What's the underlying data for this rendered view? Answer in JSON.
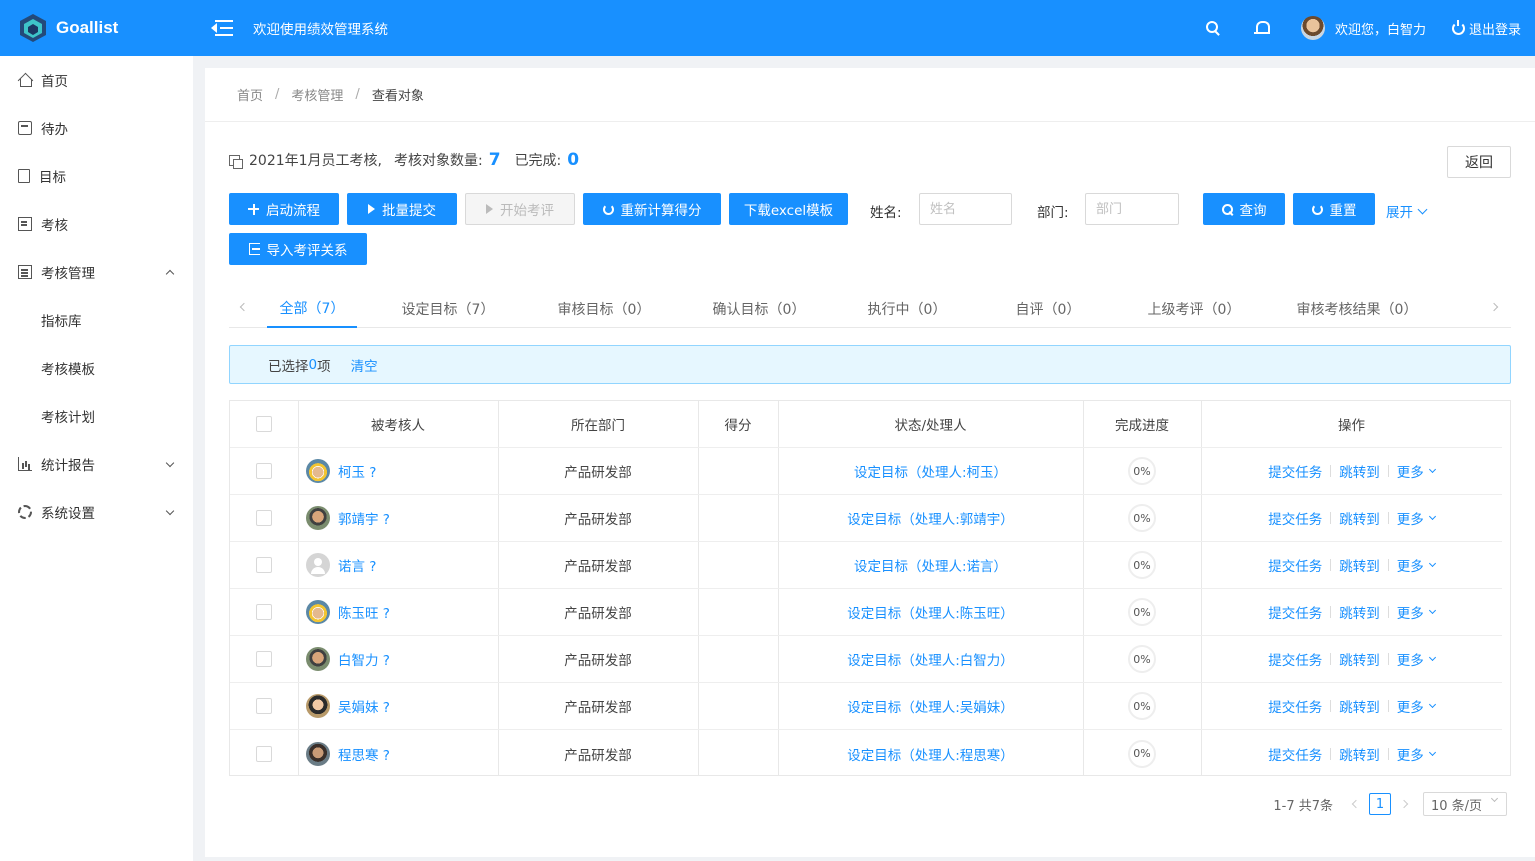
{
  "app": {
    "name": "Goallist",
    "welcome": "欢迎使用绩效管理系统"
  },
  "header": {
    "greeting": "欢迎您，白智力",
    "logout": "退出登录"
  },
  "sidebar": {
    "items": [
      {
        "label": "首页",
        "icon": "home-icon"
      },
      {
        "label": "待办",
        "icon": "calendar-icon"
      },
      {
        "label": "目标",
        "icon": "document-icon"
      },
      {
        "label": "考核",
        "icon": "checklist-icon"
      },
      {
        "label": "考核管理",
        "icon": "list-icon",
        "expanded": true
      },
      {
        "label": "指标库"
      },
      {
        "label": "考核模板"
      },
      {
        "label": "考核计划"
      },
      {
        "label": "统计报告",
        "icon": "chart-icon"
      },
      {
        "label": "系统设置",
        "icon": "gear-icon"
      }
    ]
  },
  "breadcrumb": {
    "home": "首页",
    "manage": "考核管理",
    "current": "查看对象"
  },
  "info": {
    "title": "2021年1月员工考核,",
    "count_label": "考核对象数量:",
    "count": "7",
    "done_label": "已完成:",
    "done": "0"
  },
  "buttons": {
    "back": "返回",
    "start_flow": "启动流程",
    "batch_submit": "批量提交",
    "start_review": "开始考评",
    "recalc": "重新计算得分",
    "download": "下载excel模板",
    "search": "查询",
    "reset": "重置",
    "expand": "展开",
    "import": "导入考评关系"
  },
  "filters": {
    "name_label": "姓名:",
    "name_placeholder": "姓名",
    "dept_label": "部门:",
    "dept_placeholder": "部门"
  },
  "tabs": [
    "全部（7）",
    "设定目标（7）",
    "审核目标（0）",
    "确认目标（0）",
    "执行中（0）",
    "自评（0）",
    "上级考评（0）",
    "审核考核结果（0）"
  ],
  "alert": {
    "prefix": "已选择 ",
    "count": "0",
    "suffix": "项",
    "clear": "清空"
  },
  "table": {
    "headers": [
      "被考核人",
      "所在部门",
      "得分",
      "状态/处理人",
      "完成进度",
      "操作"
    ],
    "rows": [
      {
        "name": "柯玉 ?",
        "dept": "产品研发部",
        "score": "",
        "status": "设定目标（处理人:柯玉）",
        "progress": "0%",
        "avatar": "av-hat"
      },
      {
        "name": "郭靖宇 ?",
        "dept": "产品研发部",
        "score": "",
        "status": "设定目标（处理人:郭靖宇）",
        "progress": "0%",
        "avatar": "av-man"
      },
      {
        "name": "诺言 ?",
        "dept": "产品研发部",
        "score": "",
        "status": "设定目标（处理人:诺言）",
        "progress": "0%",
        "avatar": "av-default"
      },
      {
        "name": "陈玉旺 ?",
        "dept": "产品研发部",
        "score": "",
        "status": "设定目标（处理人:陈玉旺）",
        "progress": "0%",
        "avatar": "av-hat"
      },
      {
        "name": "白智力 ?",
        "dept": "产品研发部",
        "score": "",
        "status": "设定目标（处理人:白智力）",
        "progress": "0%",
        "avatar": "av-man"
      },
      {
        "name": "吴娟妹 ?",
        "dept": "产品研发部",
        "score": "",
        "status": "设定目标（处理人:吴娟妹）",
        "progress": "0%",
        "avatar": "av-girl"
      },
      {
        "name": "程思寒 ?",
        "dept": "产品研发部",
        "score": "",
        "status": "设定目标（处理人:程思寒）",
        "progress": "0%",
        "avatar": "av-dark"
      }
    ],
    "ops": {
      "submit": "提交任务",
      "jump": "跳转到",
      "more": "更多"
    }
  },
  "pager": {
    "total": "1-7 共7条",
    "page": "1",
    "size": "10 条/页"
  }
}
